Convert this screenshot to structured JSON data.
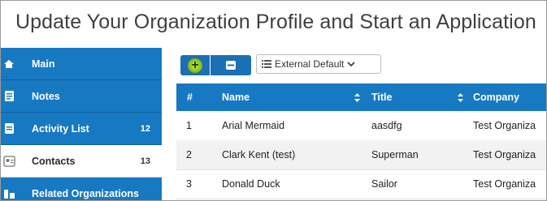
{
  "page": {
    "title": "Update Your Organization Profile and Start an Application"
  },
  "sidebar": {
    "items": [
      {
        "label": "Main",
        "count": "",
        "icon": "home-icon"
      },
      {
        "label": "Notes",
        "count": "",
        "icon": "note-icon"
      },
      {
        "label": "Activity List",
        "count": "12",
        "icon": "list-icon"
      },
      {
        "label": "Contacts",
        "count": "13",
        "icon": "contacts-icon",
        "active": true
      },
      {
        "label": "Related Organizations",
        "count": "",
        "icon": "organizations-icon"
      }
    ]
  },
  "toolbar": {
    "add_icon": "plus-icon",
    "view_icon": "card-view-icon",
    "view_select": {
      "value": "External Default",
      "icon": "list-icon"
    }
  },
  "table": {
    "columns": [
      "#",
      "Name",
      "Title",
      "Company"
    ],
    "rows": [
      {
        "num": "1",
        "name": "Arial Mermaid",
        "title": "aasdfg",
        "company": "Test Organiza"
      },
      {
        "num": "2",
        "name": "Clark Kent (test)",
        "title": "Superman",
        "company": "Test Organiza"
      },
      {
        "num": "3",
        "name": "Donald Duck",
        "title": "Sailor",
        "company": "Test Organiza"
      }
    ]
  },
  "colors": {
    "primary": "#1779c2",
    "add_button": "#8ec21f",
    "row_alt": "#f2f2f2"
  }
}
